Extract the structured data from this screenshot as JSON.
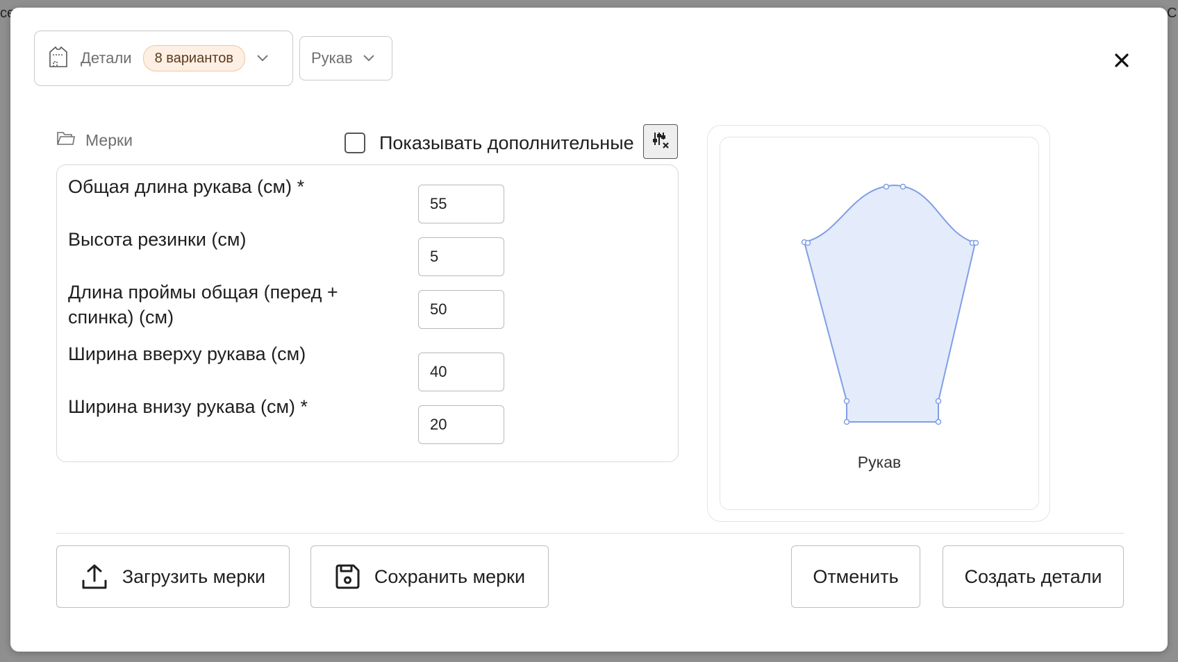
{
  "backdrop": {
    "left_fragment": "се",
    "right_fragment": "С"
  },
  "header": {
    "details_label": "Детали",
    "variants_badge": "8 вариантов",
    "part_label": "Рукав"
  },
  "measurements": {
    "title": "Мерки",
    "show_extra_label": "Показывать дополнительные",
    "show_extra_checked": false,
    "fields": [
      {
        "label": "Общая длина рукава (см) *",
        "value": "55"
      },
      {
        "label": "Высота резинки (см)",
        "value": "5"
      },
      {
        "label": "Длина проймы общая (перед + спинка) (см)",
        "value": "50"
      },
      {
        "label": "Ширина вверху рукава (см)",
        "value": "40"
      },
      {
        "label": "Ширина внизу рукава (см) *",
        "value": "20"
      }
    ]
  },
  "preview": {
    "caption": "Рукав",
    "fill_color": "#e4ebfb",
    "stroke_color": "#7f9ee6"
  },
  "footer": {
    "upload_label": "Загрузить мерки",
    "save_label": "Сохранить мерки",
    "cancel_label": "Отменить",
    "create_label": "Создать детали"
  }
}
